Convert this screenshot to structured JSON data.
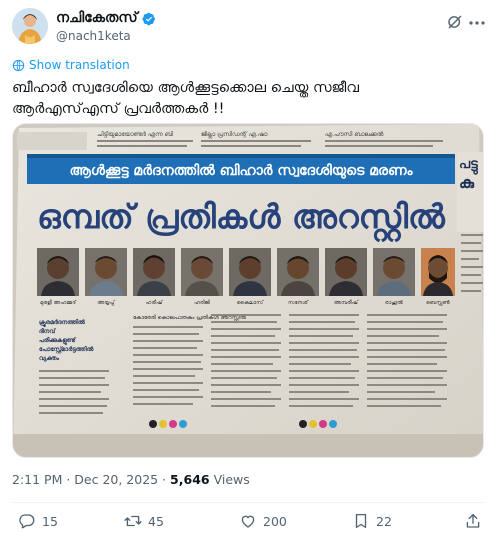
{
  "author": {
    "display_name": "നചികേതസ്",
    "handle": "@nach1keta",
    "avatar_icon": "avatar-image",
    "verified": true,
    "verified_color": "#1d9bf0"
  },
  "translate_link": "Show translation",
  "tweet": {
    "lines": [
      "ബീഹാർ സ്വദേശിയെ ആൾക്കൂട്ടക്കൊല ചെയ്ത സജീവ",
      "ആർഎസ്എസ് പ്രവർത്തകർ !!"
    ]
  },
  "newspaper": {
    "top_strip": [
      "ചിട്ടിയുമായോണ്ടർ എന്ന ബി",
      "ജില്ലാ പ്രസിഡന്റ് എ.ഷാ",
      "എ.പൗസി ബാലക്കൽ",
      "പട്ടു"
    ],
    "banner": "ആൾക്കൂട്ട മർദനത്തിൽ ബിഹാർ സ്വദേശിയുടെ മരണം",
    "headline": "ഒമ്പത് പ്രതികൾ അറസ്റ്റിൽ",
    "right_column_big": "പട്ടു",
    "right_column_big_2": "കു",
    "suspects": [
      "മുരളീ അഹമ്മദ്",
      "അയ്യപ്പ്",
      "ഹരീഷ്",
      "ഹരിജി",
      "കൈലാസ്",
      "സനേശ്",
      "അമ്പരീഷ്",
      "രാഹുൽ",
      "ബെസ്സൺ"
    ],
    "side_snippet": [
      "ക്രൂരമർദനത്തിൽ",
      "ദിനവ്",
      "പരിക്കുകളുണ്ട്",
      "പോസ്റ്റ്മോർട്ടത്തിൽ",
      "വ്യക്തം"
    ],
    "body_snippet": "കോരേരി കൊലപാതകം പ്രതികൾ അറസ്റ്റിൽ"
  },
  "timestamp": "2:11 PM · Dec 20, 2025 · ",
  "views_count": "5,646",
  "views_label": " Views",
  "actions": {
    "replies": "15",
    "reposts": "45",
    "likes": "200",
    "bookmarks": "22"
  },
  "colors": {
    "accent": "#1d9bf0",
    "text": "#0f1419",
    "secondary": "#536471",
    "headline_blue": "#27427a",
    "banner_blue": "#1e6fb5"
  }
}
